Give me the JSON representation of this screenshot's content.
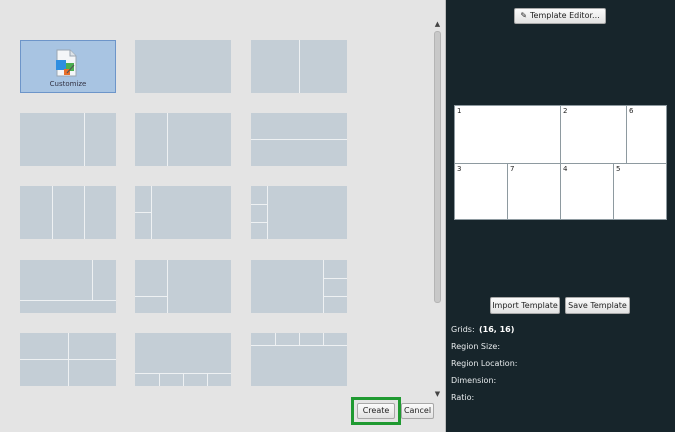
{
  "gallery": {
    "customize_label": "Customize"
  },
  "actions": {
    "create_label": "Create",
    "cancel_label": "Cancel"
  },
  "editor": {
    "template_editor_label": "Template Editor...",
    "import_label": "Import Template",
    "save_label": "Save Template"
  },
  "preview": {
    "regions": [
      "1",
      "2",
      "6",
      "3",
      "7",
      "4",
      "5"
    ]
  },
  "info": {
    "grids_label": "Grids:",
    "grids_value": "(16, 16)",
    "region_size_label": "Region Size:",
    "region_location_label": "Region Location:",
    "dimension_label": "Dimension:",
    "ratio_label": "Ratio:"
  },
  "colors": {
    "right_pane_bg": "#17252b",
    "tile_bg": "#c4ced6",
    "tile_selected_bg": "#a8c4e2",
    "highlight": "#1f9a31"
  }
}
